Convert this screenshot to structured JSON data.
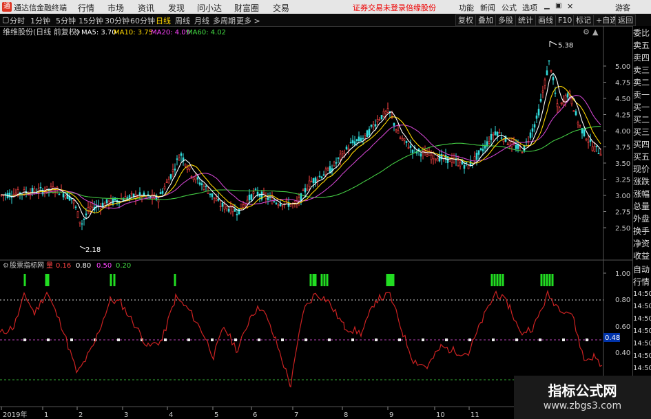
{
  "titlebar": {
    "app_name": "通达信金融终端",
    "menus": [
      "行情",
      "市场",
      "资讯",
      "发现",
      "问小达",
      "财富圈",
      "交易"
    ],
    "warning": "证券交易未登录",
    "broker": "倍缘股份",
    "right_items": [
      "功能",
      "新闻",
      "公式",
      "选项"
    ],
    "guest": "游客",
    "logo_glyph": "通"
  },
  "toolbar": {
    "periods": [
      "分时",
      "1分钟",
      "5分钟",
      "15分钟",
      "30分钟",
      "60分钟",
      "日线",
      "周线",
      "月线",
      "多周期",
      "更多 >"
    ],
    "active_period": "日线",
    "buttons": [
      "复权",
      "叠加",
      "多股",
      "统计",
      "画线",
      "F10",
      "标记",
      "+自选",
      "返回"
    ]
  },
  "main_chart": {
    "title": "维维股份(日线 前复权)",
    "ma_labels": [
      {
        "text": "MA5: 3.70",
        "color": "#ffffff"
      },
      {
        "text": "MA10: 3.75",
        "color": "#ffd700"
      },
      {
        "text": "MA20: 4.09",
        "color": "#ff44ff"
      },
      {
        "text": "MA60: 4.02",
        "color": "#44dd44"
      }
    ],
    "high_label": "5.38",
    "low_label": "2.18",
    "y_ticks": [
      "5.00",
      "4.75",
      "4.50",
      "4.25",
      "4.00",
      "3.75",
      "3.50",
      "3.25",
      "3.00",
      "2.75",
      "2.50"
    ]
  },
  "indicator": {
    "title": "股票指标网",
    "label_vol": "量",
    "values": [
      {
        "text": "0.16",
        "color": "#ff4444"
      },
      {
        "text": "0.80",
        "color": "#ffffff"
      },
      {
        "text": "0.50",
        "color": "#ff44ff"
      },
      {
        "text": "0.20",
        "color": "#44dd44"
      }
    ],
    "y_ticks": [
      "1.00",
      "0.80",
      "0.60",
      "0.40"
    ],
    "current_value": "0.48",
    "right_times": [
      "14:50",
      "14:50",
      "14:50",
      "14:50",
      "14:50",
      "14:50",
      "14:50"
    ]
  },
  "x_axis": {
    "labels": [
      "2019年",
      "1",
      "2",
      "3",
      "4",
      "5",
      "6",
      "7",
      "8",
      "9",
      "10",
      "11"
    ]
  },
  "right_panel": {
    "items": [
      "委比",
      "卖五",
      "卖四",
      "卖三",
      "卖二",
      "卖一",
      "买一",
      "买二",
      "买三",
      "买四",
      "买五",
      "现价",
      "涨跌",
      "涨幅",
      "总量",
      "外盘",
      "换手",
      "净资",
      "收益"
    ],
    "bottom_items": [
      "自动",
      "行情"
    ]
  },
  "watermark": {
    "line1": "指标公式网",
    "line2": "www.zbgs3.com"
  },
  "colors": {
    "candle_up": "#ff4444",
    "candle_dn": "#33dddd",
    "ma5": "#ffffff",
    "ma10": "#ffd700",
    "ma20": "#cc44cc",
    "ma60": "#44cc44",
    "osc": "#cc2222",
    "signal": "#22dd22"
  }
}
